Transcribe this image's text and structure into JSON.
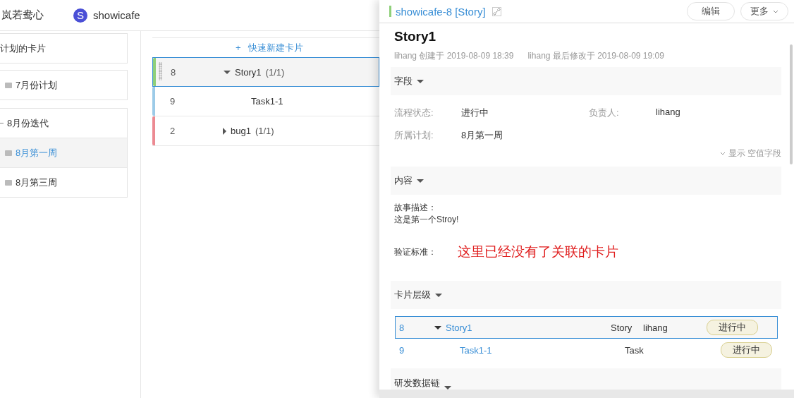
{
  "header": {
    "brand": "岚若鸯心",
    "project_initial": "S",
    "project": "showicafe"
  },
  "sidebar": [
    {
      "label": "计划的卡片",
      "kind": "plain",
      "selected": false
    },
    {
      "label": "7月份计划",
      "kind": "plan",
      "selected": false
    },
    {
      "label": "8月份迭代",
      "kind": "iteration",
      "expanded": true,
      "selected": false,
      "children": [
        {
          "label": "8月第一周",
          "kind": "plan",
          "selected": true
        },
        {
          "label": "8月第三周",
          "kind": "plan",
          "selected": false
        }
      ]
    }
  ],
  "board": {
    "quick_add": "快速新建卡片",
    "quick_add_icon": "+",
    "rows": [
      {
        "id": "8",
        "title": "Story1",
        "count": "(1/1)",
        "color": "#8fd07a",
        "selected": true,
        "expanded": true,
        "children": [
          {
            "id": "9",
            "title": "Task1-1",
            "color": "#9ccbe8",
            "selected": false
          }
        ]
      },
      {
        "id": "2",
        "title": "bug1",
        "count": "(1/1)",
        "color": "#ec8a92",
        "selected": false,
        "expanded": false
      }
    ]
  },
  "panel": {
    "title": "showicafe-8 [Story]",
    "buttons": [
      {
        "label": "编辑",
        "kind": "plain"
      },
      {
        "label": "更多",
        "kind": "menu"
      }
    ],
    "card_title": "Story1",
    "created": "lihang 创建于 2019-08-09 18:39",
    "modified": "lihang 最后修改于 2019-08-09 19:09",
    "fields_section": {
      "title": "字段",
      "expanded": true
    },
    "fields": [
      {
        "label": "流程状态:",
        "value": "进行中"
      },
      {
        "label": "负责人:",
        "value": "lihang"
      },
      {
        "label": "所属计划:",
        "value": "8月第一周"
      }
    ],
    "show_empty": "显示 空值字段",
    "content_section": {
      "title": "内容",
      "expanded": true
    },
    "description_label": "故事描述：",
    "description": "这是第一个Stroy!",
    "acceptance_label": "验证标准：",
    "annotation": "这里已经没有了关联的卡片",
    "hierarchy_section": {
      "title": "卡片层级",
      "expanded": true
    },
    "hierarchy": [
      {
        "id": "8",
        "title": "Story1",
        "type": "Story",
        "owner": "lihang",
        "status": "进行中",
        "selected": true,
        "expanded": true,
        "children": [
          {
            "id": "9",
            "title": "Task1-1",
            "type": "Task",
            "status": "进行中",
            "selected": false
          }
        ]
      }
    ],
    "data_section": {
      "title": "研发数据链",
      "expanded": true
    }
  }
}
